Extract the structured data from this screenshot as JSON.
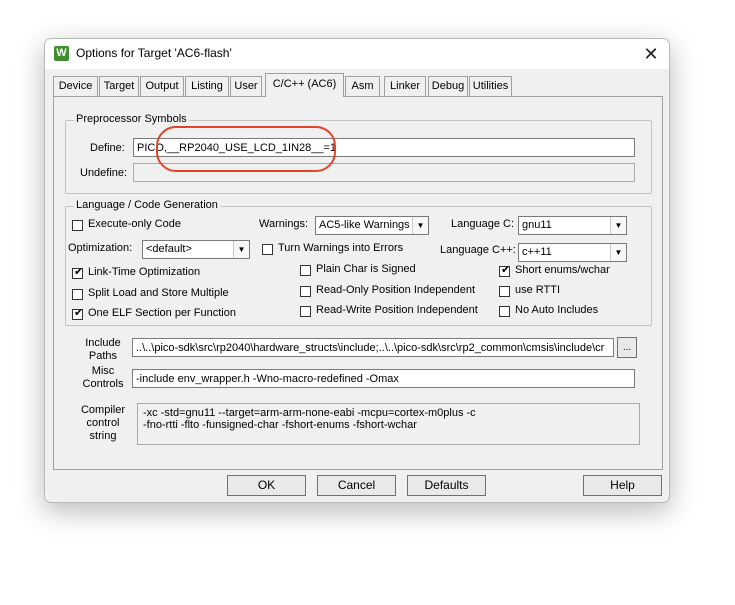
{
  "window": {
    "title": "Options for Target 'AC6-flash'",
    "icon": "uvision-icon",
    "close": "✕"
  },
  "tabs": [
    "Device",
    "Target",
    "Output",
    "Listing",
    "User",
    "C/C++ (AC6)",
    "Asm",
    "Linker",
    "Debug",
    "Utilities"
  ],
  "active_tab": "C/C++ (AC6)",
  "preprocessor": {
    "legend": "Preprocessor Symbols",
    "define_label": "Define:",
    "define_value": "PICO,__RP2040_USE_LCD_1IN28__=1",
    "undefine_label": "Undefine:",
    "undefine_value": ""
  },
  "codegen": {
    "legend": "Language / Code Generation",
    "execute_only": {
      "label": "Execute-only Code",
      "checked": false
    },
    "optimization_label": "Optimization:",
    "optimization_value": "<default>",
    "lto": {
      "label": "Link-Time Optimization",
      "checked": true
    },
    "split_load": {
      "label": "Split Load and Store Multiple",
      "checked": false
    },
    "one_elf": {
      "label": "One ELF Section per Function",
      "checked": true
    },
    "warnings_label": "Warnings:",
    "warnings_value": "AC5-like Warnings",
    "turn_warnings": {
      "label": "Turn Warnings into Errors",
      "checked": false
    },
    "plain_char": {
      "label": "Plain Char is Signed",
      "checked": false
    },
    "ro_pi": {
      "label": "Read-Only Position Independent",
      "checked": false
    },
    "rw_pi": {
      "label": "Read-Write Position Independent",
      "checked": false
    },
    "lang_c_label": "Language C:",
    "lang_c_value": "gnu11",
    "lang_cpp_label": "Language C++:",
    "lang_cpp_value": "c++11",
    "short_enums": {
      "label": "Short enums/wchar",
      "checked": true
    },
    "use_rtti": {
      "label": "use RTTI",
      "checked": false
    },
    "no_auto_includes": {
      "label": "No Auto Includes",
      "checked": false
    }
  },
  "include": {
    "label_line1": "Include",
    "label_line2": "Paths",
    "value": "..\\..\\pico-sdk\\src\\rp2040\\hardware_structs\\include;..\\..\\pico-sdk\\src\\rp2_common\\cmsis\\include\\cr",
    "browse": "..."
  },
  "misc": {
    "label_line1": "Misc",
    "label_line2": "Controls",
    "value": "-include env_wrapper.h -Wno-macro-redefined -Omax"
  },
  "compiler": {
    "label_line1": "Compiler",
    "label_line2": "control",
    "label_line3": "string",
    "line1": "-xc -std=gnu11 --target=arm-arm-none-eabi -mcpu=cortex-m0plus -c",
    "line2": "-fno-rtti -flto -funsigned-char -fshort-enums -fshort-wchar"
  },
  "buttons": {
    "ok": "OK",
    "cancel": "Cancel",
    "defaults": "Defaults",
    "help": "Help"
  },
  "colors": {
    "annotation": "#e0452c",
    "dialog_bg": "#f0f0f0"
  }
}
